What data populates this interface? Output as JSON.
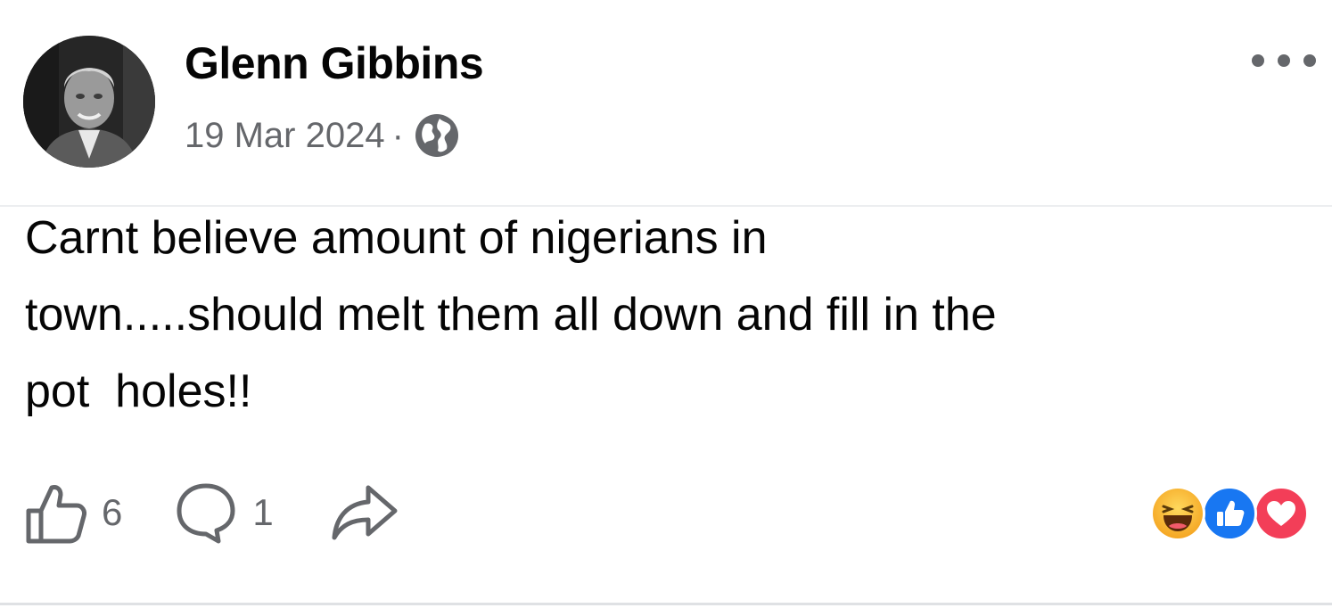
{
  "post": {
    "author": {
      "name": "Glenn Gibbins",
      "avatar_icon": "profile-photo"
    },
    "meta": {
      "date": "19 Mar 2024",
      "separator": "·",
      "audience_icon": "globe-icon"
    },
    "more_icon": "more-options-icon",
    "text": "Carnt believe amount of nigerians in\ntown.....should melt them all down and fill in the\npot  holes!!",
    "actions": {
      "like": {
        "icon": "thumbs-up-icon",
        "count": "6"
      },
      "comment": {
        "icon": "comment-icon",
        "count": "1"
      },
      "share": {
        "icon": "share-icon"
      }
    },
    "reactions": [
      "haha",
      "like",
      "love"
    ]
  },
  "colors": {
    "primary_text": "#050505",
    "secondary_text": "#65676b",
    "like_blue": "#1877f2",
    "love_red": "#f33e58",
    "haha_yellow": "#f7b125"
  }
}
